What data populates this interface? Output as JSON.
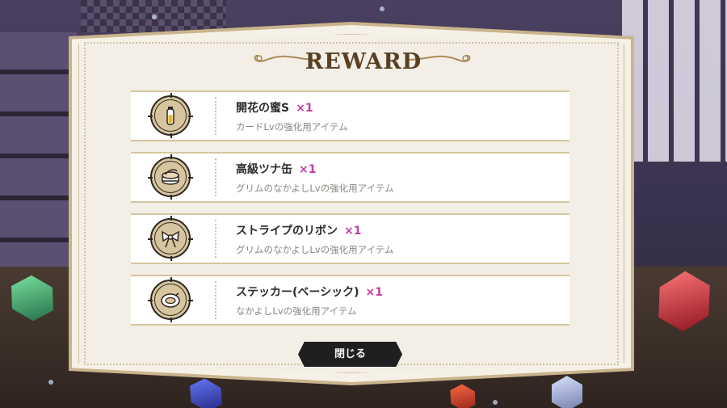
{
  "dialog": {
    "title": "REWARD",
    "close_label": "閉じる"
  },
  "rewards": [
    {
      "name": "開花の蜜S",
      "qty": "×1",
      "desc": "カードLvの強化用アイテム",
      "icon": "honey-vial-icon"
    },
    {
      "name": "高級ツナ缶",
      "qty": "×1",
      "desc": "グリムのなかよしLvの強化用アイテム",
      "icon": "tuna-can-icon"
    },
    {
      "name": "ストライプのリボン",
      "qty": "×1",
      "desc": "グリムのなかよしLvの強化用アイテム",
      "icon": "ribbon-bow-icon"
    },
    {
      "name": "ステッカー(ベーシック)",
      "qty": "×1",
      "desc": "なかよしLvの強化用アイテム",
      "icon": "sticker-icon"
    }
  ],
  "colors": {
    "accent_qty": "#c43ca8",
    "panel_gold": "#c9b48c",
    "button_dark": "#1f1f22"
  }
}
